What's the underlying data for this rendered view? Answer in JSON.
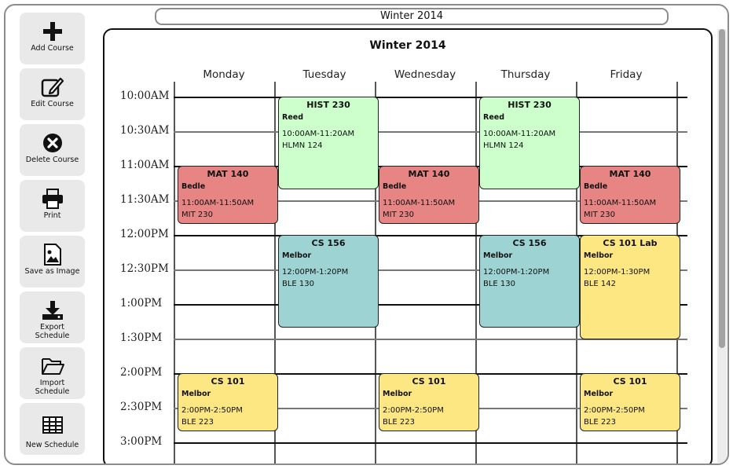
{
  "schedule_name_input": "Winter 2014",
  "sidebar": {
    "items": [
      {
        "label": "Add Course",
        "icon": "plus-icon"
      },
      {
        "label": "Edit Course",
        "icon": "edit-icon"
      },
      {
        "label": "Delete Course",
        "icon": "delete-circle-icon"
      },
      {
        "label": "Print",
        "icon": "printer-icon"
      },
      {
        "label": "Save as Image",
        "icon": "image-icon"
      },
      {
        "label": "Export\nSchedule",
        "icon": "download-icon"
      },
      {
        "label": "Import\nSchedule",
        "icon": "folder-icon"
      },
      {
        "label": "New Schedule",
        "icon": "table-icon"
      }
    ]
  },
  "schedule": {
    "title": "Winter 2014",
    "days": [
      "Monday",
      "Tuesday",
      "Wednesday",
      "Thursday",
      "Friday"
    ],
    "times": [
      "10:00AM",
      "10:30AM",
      "11:00AM",
      "11:30AM",
      "12:00PM",
      "12:30PM",
      "1:00PM",
      "1:30PM",
      "2:00PM",
      "2:30PM",
      "3:00PM"
    ],
    "courses": [
      {
        "code": "HIST 230",
        "instructor": "Reed",
        "time": "10:00AM-11:20AM",
        "room": "HLMN 124",
        "color": "#ccffcc"
      },
      {
        "code": "MAT 140",
        "instructor": "Bedle",
        "time": "11:00AM-11:50AM",
        "room": "MIT 230",
        "color": "#e78585"
      },
      {
        "code": "CS 156",
        "instructor": "Melbor",
        "time": "12:00PM-1:20PM",
        "room": "BLE 130",
        "color": "#9ed3d3"
      },
      {
        "code": "CS 101 Lab",
        "instructor": "Melbor",
        "time": "12:00PM-1:30PM",
        "room": "BLE 142",
        "color": "#fce783"
      },
      {
        "code": "CS 101",
        "instructor": "Melbor",
        "time": "2:00PM-2:50PM",
        "room": "BLE 223",
        "color": "#fce783"
      }
    ]
  }
}
